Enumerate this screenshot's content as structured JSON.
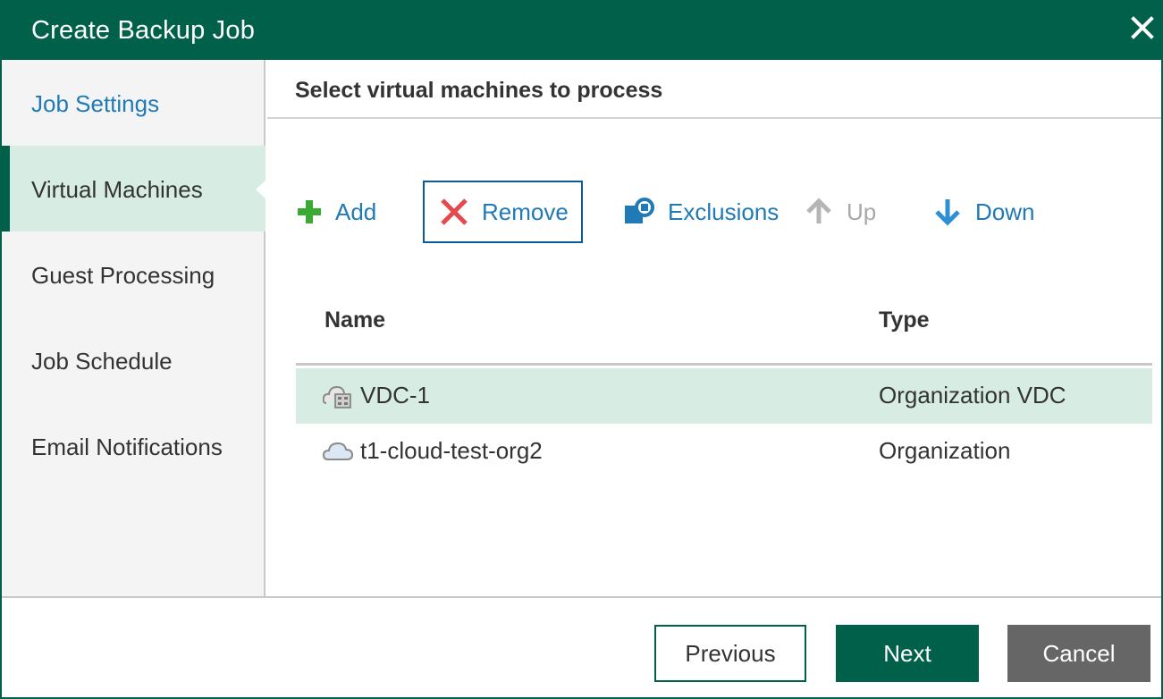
{
  "window": {
    "title": "Create Backup Job",
    "close_icon": "close-icon"
  },
  "sidebar": {
    "items": [
      {
        "label": "Job Settings",
        "state": "done"
      },
      {
        "label": "Virtual Machines",
        "state": "active"
      },
      {
        "label": "Guest Processing",
        "state": "pending"
      },
      {
        "label": "Job Schedule",
        "state": "pending"
      },
      {
        "label": "Email Notifications",
        "state": "pending"
      }
    ]
  },
  "main": {
    "heading": "Select virtual machines to process",
    "toolbar": {
      "add": "Add",
      "remove": "Remove",
      "exclusions": "Exclusions",
      "up": "Up",
      "down": "Down"
    },
    "table": {
      "columns": {
        "name": "Name",
        "type": "Type"
      },
      "rows": [
        {
          "name": "VDC-1",
          "type": "Organization VDC",
          "icon": "vdc-icon",
          "selected": true
        },
        {
          "name": "t1-cloud-test-org2",
          "type": "Organization",
          "icon": "cloud-icon",
          "selected": false
        }
      ]
    }
  },
  "footer": {
    "previous": "Previous",
    "next": "Next",
    "cancel": "Cancel"
  },
  "colors": {
    "brand": "#00604a",
    "link": "#1f7ab5",
    "selected_row": "#d7ede4",
    "remove_red": "#e5484d",
    "add_green": "#3aaa35"
  }
}
